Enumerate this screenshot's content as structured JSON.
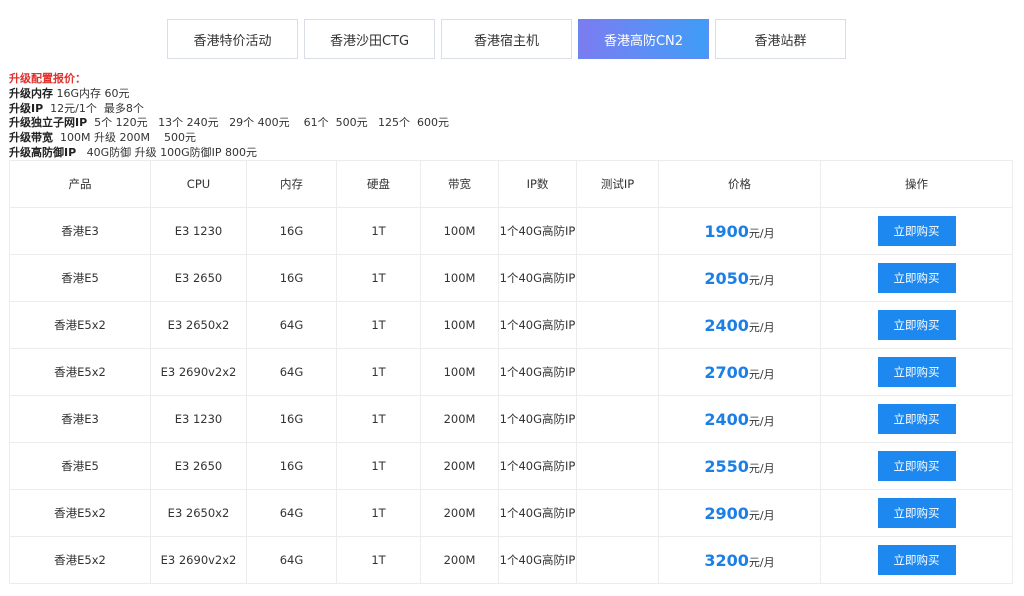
{
  "tabs": [
    {
      "label": "香港特价活动",
      "active": false
    },
    {
      "label": "香港沙田CTG",
      "active": false
    },
    {
      "label": "香港宿主机",
      "active": false
    },
    {
      "label": "香港高防CN2",
      "active": true
    },
    {
      "label": "香港站群",
      "active": false
    }
  ],
  "upgrade": {
    "heading": "升级配置报价：",
    "rows": [
      {
        "label": "升级内存",
        "value": " 16G内存 60元"
      },
      {
        "label": "升级IP",
        "value": "  12元/1个  最多8个"
      },
      {
        "label": "升级独立子网IP",
        "value": "  5个 120元   13个 240元   29个 400元    61个  500元   125个  600元"
      },
      {
        "label": "升级带宽",
        "value": "  100M 升级 200M    500元"
      },
      {
        "label": "升级高防御IP",
        "value": "   40G防御 升级 100G防御IP 800元"
      }
    ]
  },
  "table": {
    "headers": [
      "产品",
      "CPU",
      "内存",
      "硬盘",
      "带宽",
      "IP数",
      "测试IP",
      "价格",
      "操作"
    ],
    "price_unit": "元/月",
    "buy_label": "立即购买",
    "rows": [
      {
        "product": "香港E3",
        "cpu": "E3 1230",
        "ram": "16G",
        "disk": "1T",
        "bw": "100M",
        "ip": "1个40G高防IP",
        "test_ip": "",
        "price": "1900"
      },
      {
        "product": "香港E5",
        "cpu": "E3 2650",
        "ram": "16G",
        "disk": "1T",
        "bw": "100M",
        "ip": "1个40G高防IP",
        "test_ip": "",
        "price": "2050"
      },
      {
        "product": "香港E5x2",
        "cpu": "E3 2650x2",
        "ram": "64G",
        "disk": "1T",
        "bw": "100M",
        "ip": "1个40G高防IP",
        "test_ip": "",
        "price": "2400"
      },
      {
        "product": "香港E5x2",
        "cpu": "E3 2690v2x2",
        "ram": "64G",
        "disk": "1T",
        "bw": "100M",
        "ip": "1个40G高防IP",
        "test_ip": "",
        "price": "2700"
      },
      {
        "product": "香港E3",
        "cpu": "E3 1230",
        "ram": "16G",
        "disk": "1T",
        "bw": "200M",
        "ip": "1个40G高防IP",
        "test_ip": "",
        "price": "2400"
      },
      {
        "product": "香港E5",
        "cpu": "E3 2650",
        "ram": "16G",
        "disk": "1T",
        "bw": "200M",
        "ip": "1个40G高防IP",
        "test_ip": "",
        "price": "2550"
      },
      {
        "product": "香港E5x2",
        "cpu": "E3 2650x2",
        "ram": "64G",
        "disk": "1T",
        "bw": "200M",
        "ip": "1个40G高防IP",
        "test_ip": "",
        "price": "2900"
      },
      {
        "product": "香港E5x2",
        "cpu": "E3 2690v2x2",
        "ram": "64G",
        "disk": "1T",
        "bw": "200M",
        "ip": "1个40G高防IP",
        "test_ip": "",
        "price": "3200"
      }
    ]
  },
  "colors": {
    "accent": "#1c88f0",
    "price": "#1b7fe6",
    "heading": "#e0322d"
  }
}
